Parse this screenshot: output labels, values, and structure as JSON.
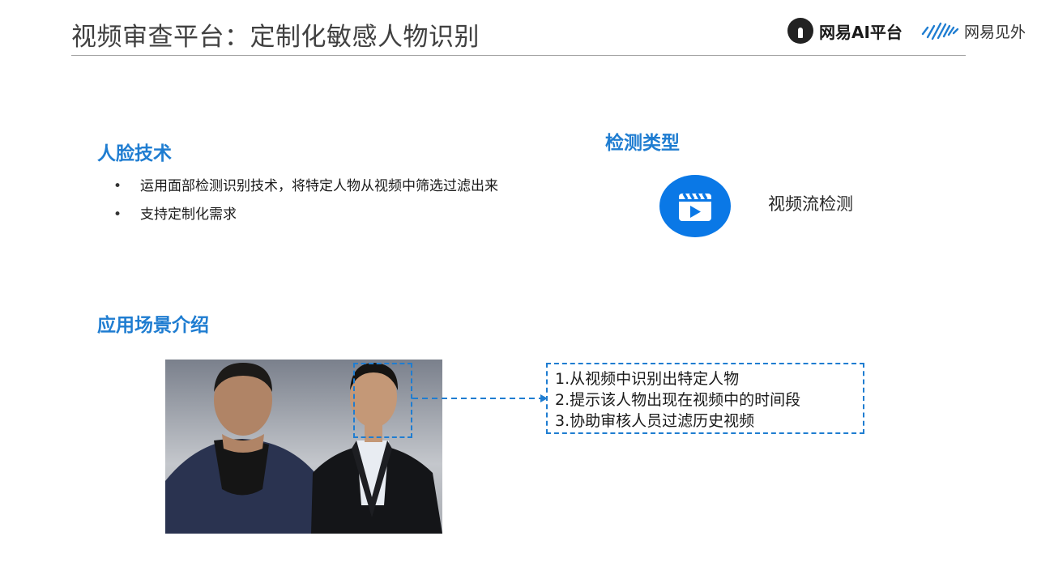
{
  "header": {
    "title": "视频审查平台：定制化敏感人物识别",
    "logo_ai_text": "网易AI平台",
    "logo_jw_text": "网易见外"
  },
  "face_tech": {
    "heading": "人脸技术",
    "bullets": [
      "运用面部检测识别技术，将特定人物从视频中筛选过滤出来",
      "支持定制化需求"
    ]
  },
  "detection": {
    "heading": "检测类型",
    "icon": "video-play-icon",
    "label": "视频流检测"
  },
  "scenario": {
    "heading": "应用场景介绍",
    "lines": [
      "1.从视频中识别出特定人物",
      "2.提示该人物出现在视频中的时间段",
      "3.协助审核人员过滤历史视频"
    ]
  },
  "colors": {
    "accent": "#1f7dd1",
    "icon_blue": "#0a78e6",
    "title_gray": "#404040"
  }
}
